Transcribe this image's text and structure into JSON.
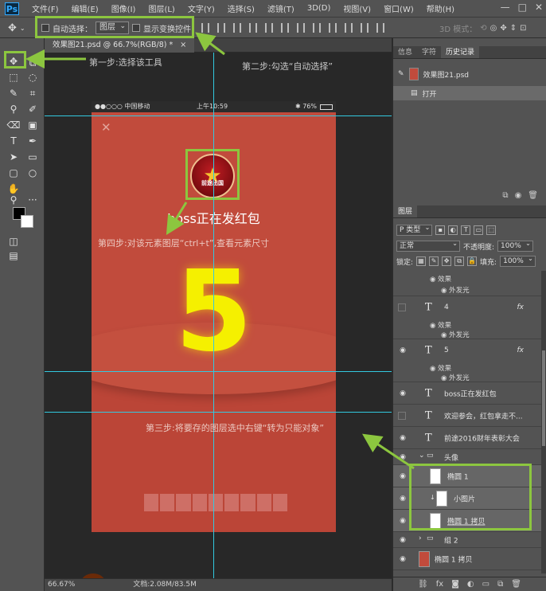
{
  "app": {
    "logo": "Ps"
  },
  "menu": [
    "文件(F)",
    "编辑(E)",
    "图像(I)",
    "图层(L)",
    "文字(Y)",
    "选择(S)",
    "滤镜(T)",
    "3D(D)",
    "视图(V)",
    "窗口(W)",
    "帮助(H)"
  ],
  "window_controls": [
    "—",
    "□",
    "✕"
  ],
  "options": {
    "auto_select_label": "自动选择：",
    "auto_select_target": "图层",
    "show_transform_label": "显示变换控件",
    "mode_3d_label": "3D 模式："
  },
  "doc_tab": {
    "title": "效果图21.psd @ 66.7%(RGB/8) *",
    "close": "×"
  },
  "status_bar": {
    "zoom": "66.67%",
    "doc_size": "文档:2.08M/83.5M"
  },
  "phone": {
    "status_left": "●●○○○ 中国移动 ",
    "status_time": "上午10:59",
    "status_right": "✱ 76%",
    "close_icon": "✕",
    "avatar_text": "前途出国",
    "title": "boss正在发红包",
    "countdown": "5"
  },
  "annotations": {
    "step1": "第一步:选择该工具",
    "step2": "第二步:勾选“自动选择”",
    "step3": "第三步:将要存的图层选中右键“转为只能对象”",
    "step4": "第四步:对该元素图层“ctrl+t”,查看元素尺寸"
  },
  "history_panel": {
    "tabs": [
      "信息",
      "字符",
      "历史记录"
    ],
    "active_tab": "历史记录",
    "snapshot": "效果图21.psd",
    "steps": [
      "打开"
    ]
  },
  "layers_panel": {
    "tab": "图层",
    "filter_kind": "P 类型",
    "blend_mode": "正常",
    "opacity_label": "不透明度:",
    "opacity_value": "100%",
    "lock_label": "锁定:",
    "fill_label": "填充:",
    "fill_value": "100%",
    "effects_label": "效果",
    "outer_glow_label": "外发光",
    "layers": [
      {
        "name": "4",
        "type": "text",
        "fx": "fx",
        "visible": false
      },
      {
        "name": "5",
        "type": "text",
        "fx": "fx",
        "visible": true
      },
      {
        "name": "boss正在发红包",
        "type": "text",
        "visible": true
      },
      {
        "name": "欢迎参会，红包拿走不...",
        "type": "text",
        "visible": false
      },
      {
        "name": "前途2016财年表彰大会",
        "type": "text",
        "visible": true
      },
      {
        "name": "头像",
        "type": "group",
        "visible": true
      },
      {
        "name": "椭圆 1",
        "type": "shape",
        "visible": true
      },
      {
        "name": "小图片",
        "type": "image",
        "visible": true
      },
      {
        "name": "椭圆 1 拷贝",
        "type": "shape",
        "visible": true
      },
      {
        "name": "组 2",
        "type": "group",
        "visible": true
      },
      {
        "name": "椭圆 1 拷贝",
        "type": "shape",
        "visible": true
      }
    ]
  },
  "colors": {
    "accent_green": "#8cc63f",
    "guide_cyan": "#32c9e0",
    "phone_red": "#c14b3c",
    "countdown_yellow": "#f5f000"
  }
}
